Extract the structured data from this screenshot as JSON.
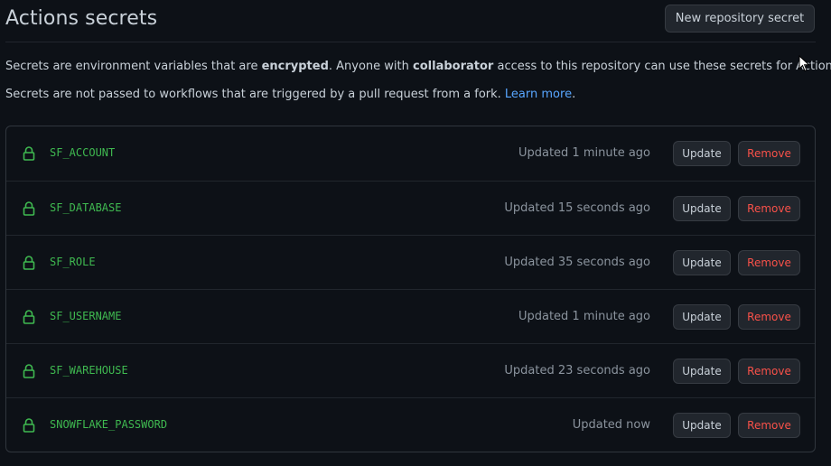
{
  "header": {
    "title": "Actions secrets",
    "new_secret_label": "New repository secret"
  },
  "description": {
    "line1_part1": "Secrets are environment variables that are ",
    "line1_bold1": "encrypted",
    "line1_part2": ". Anyone with ",
    "line1_bold2": "collaborator",
    "line1_part3": " access to this repository can use these secrets for Actions.",
    "line2_text": "Secrets are not passed to workflows that are triggered by a pull request from a fork. ",
    "line2_link": "Learn more",
    "line2_end": "."
  },
  "secrets": [
    {
      "name": "SF_ACCOUNT",
      "updated": "Updated 1 minute ago",
      "update_label": "Update",
      "remove_label": "Remove"
    },
    {
      "name": "SF_DATABASE",
      "updated": "Updated 15 seconds ago",
      "update_label": "Update",
      "remove_label": "Remove"
    },
    {
      "name": "SF_ROLE",
      "updated": "Updated 35 seconds ago",
      "update_label": "Update",
      "remove_label": "Remove"
    },
    {
      "name": "SF_USERNAME",
      "updated": "Updated 1 minute ago",
      "update_label": "Update",
      "remove_label": "Remove"
    },
    {
      "name": "SF_WAREHOUSE",
      "updated": "Updated 23 seconds ago",
      "update_label": "Update",
      "remove_label": "Remove"
    },
    {
      "name": "SNOWFLAKE_PASSWORD",
      "updated": "Updated now",
      "update_label": "Update",
      "remove_label": "Remove"
    }
  ],
  "icons": {
    "secret": "lock-icon",
    "pointer": "mouse-cursor-icon"
  },
  "colors": {
    "background": "#0d1117",
    "secret_name": "#3fb950",
    "remove": "#f85149",
    "link": "#58a6ff"
  }
}
